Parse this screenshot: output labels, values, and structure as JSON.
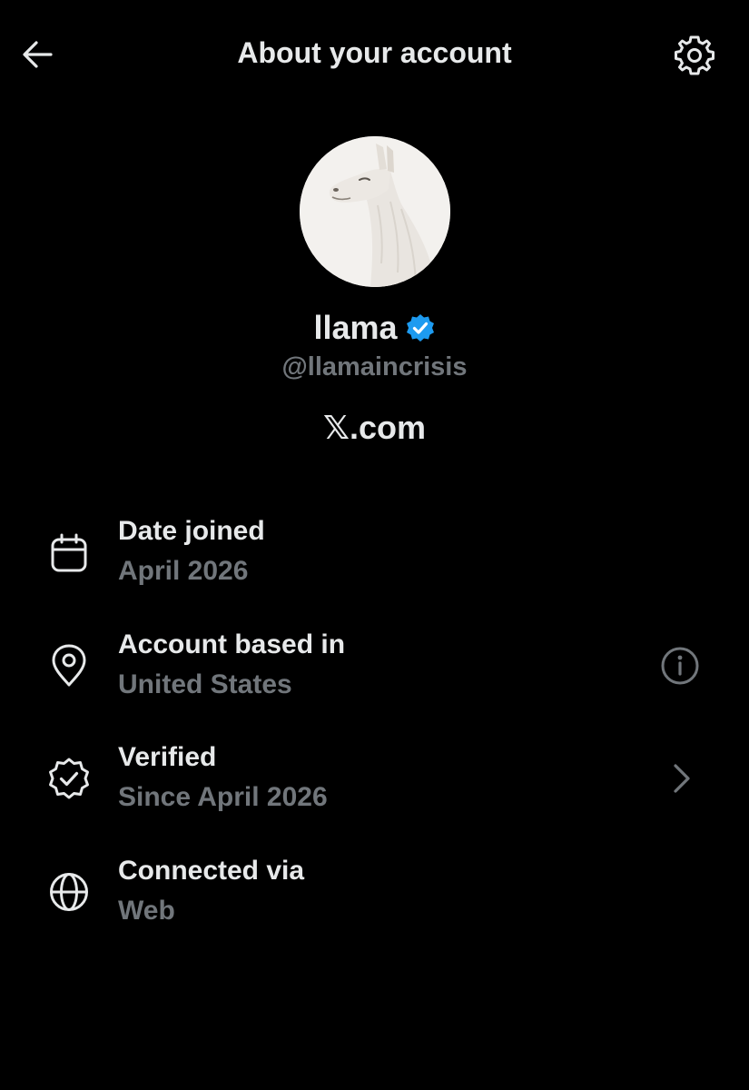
{
  "header": {
    "title": "About your account",
    "back_icon": "arrow-left-icon",
    "settings_icon": "gear-icon"
  },
  "profile": {
    "display_name": "llama",
    "handle": "@llamaincrisis",
    "platform_x": "𝕏",
    "platform_suffix": ".com",
    "verified_color": "#1d9bf0"
  },
  "details": [
    {
      "icon": "calendar-icon",
      "label": "Date joined",
      "value": "April 2026"
    },
    {
      "icon": "location-pin-icon",
      "label": "Account based in",
      "value": "United States",
      "trailing_icon": "info-icon"
    },
    {
      "icon": "verified-badge-icon",
      "label": "Verified",
      "value": "Since April 2026",
      "trailing_icon": "chevron-right-icon"
    },
    {
      "icon": "globe-icon",
      "label": "Connected via",
      "value": "Web"
    }
  ],
  "colors": {
    "background": "#000000",
    "primary_text": "#e7e9ea",
    "secondary_text": "#71767b",
    "accent": "#1d9bf0"
  }
}
